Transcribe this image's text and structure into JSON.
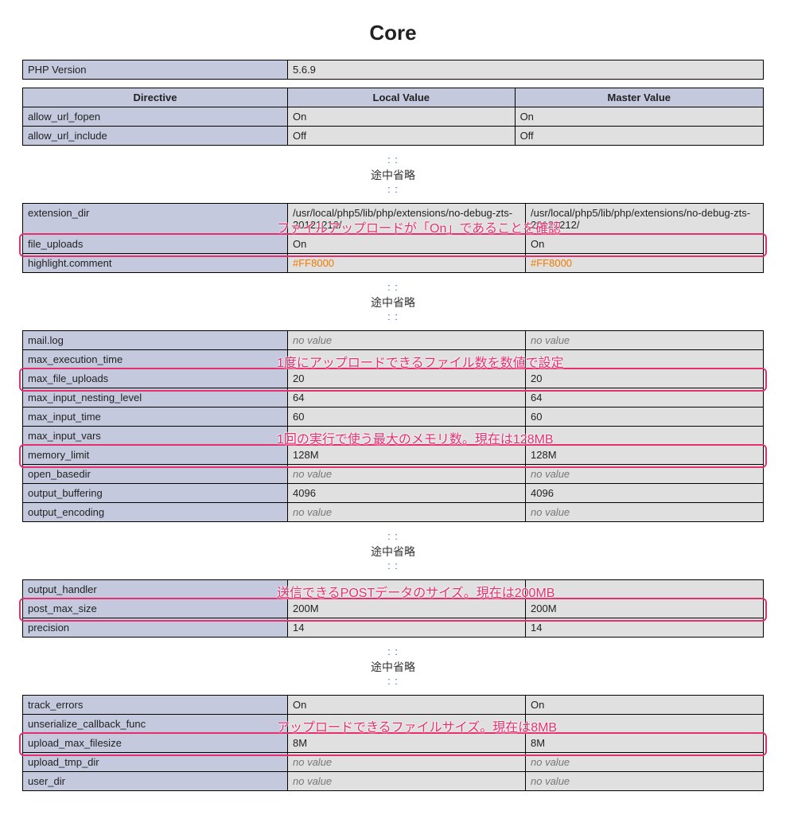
{
  "title": "Core",
  "omit_label": "途中省略",
  "php_version_row": {
    "name": "PHP Version",
    "value": "5.6.9"
  },
  "headers": {
    "directive": "Directive",
    "local": "Local Value",
    "master": "Master Value"
  },
  "section1": [
    {
      "name": "allow_url_fopen",
      "local": "On",
      "master": "On"
    },
    {
      "name": "allow_url_include",
      "local": "Off",
      "master": "Off"
    }
  ],
  "section2": [
    {
      "name": "extension_dir",
      "local": "/usr/local/php5/lib/php/extensions/no-debug-zts-20121212/",
      "master": "/usr/local/php5/lib/php/extensions/no-debug-zts-20121212/"
    },
    {
      "name": "file_uploads",
      "local": "On",
      "master": "On",
      "highlight": true
    },
    {
      "name": "highlight.comment",
      "local": "#FF8000",
      "master": "#FF8000",
      "color": "orange"
    }
  ],
  "section3": [
    {
      "name": "mail.log",
      "local": "no value",
      "master": "no value",
      "style": "italic"
    },
    {
      "name": "max_execution_time",
      "local": "",
      "master": ""
    },
    {
      "name": "max_file_uploads",
      "local": "20",
      "master": "20",
      "highlight": true
    },
    {
      "name": "max_input_nesting_level",
      "local": "64",
      "master": "64"
    },
    {
      "name": "max_input_time",
      "local": "60",
      "master": "60"
    },
    {
      "name": "max_input_vars",
      "local": "",
      "master": ""
    },
    {
      "name": "memory_limit",
      "local": "128M",
      "master": "128M",
      "highlight": true
    },
    {
      "name": "open_basedir",
      "local": "no value",
      "master": "no value",
      "style": "italic"
    },
    {
      "name": "output_buffering",
      "local": "4096",
      "master": "4096"
    },
    {
      "name": "output_encoding",
      "local": "no value",
      "master": "no value",
      "style": "italic"
    }
  ],
  "section4": [
    {
      "name": "output_handler",
      "local": "",
      "master": ""
    },
    {
      "name": "post_max_size",
      "local": "200M",
      "master": "200M",
      "highlight": true
    },
    {
      "name": "precision",
      "local": "14",
      "master": "14"
    }
  ],
  "section5": [
    {
      "name": "track_errors",
      "local": "On",
      "master": "On"
    },
    {
      "name": "unserialize_callback_func",
      "local": "",
      "master": ""
    },
    {
      "name": "upload_max_filesize",
      "local": "8M",
      "master": "8M",
      "highlight": true
    },
    {
      "name": "upload_tmp_dir",
      "local": "no value",
      "master": "no value",
      "style": "italic"
    },
    {
      "name": "user_dir",
      "local": "no value",
      "master": "no value",
      "style": "italic"
    }
  ],
  "annotations": {
    "file_uploads": "ファイルアップロードが「On」であることを確認",
    "max_file_uploads": "1度にアップロードできるファイル数を数値で設定",
    "memory_limit": "1回の実行で使う最大のメモリ数。現在は128MB",
    "post_max_size": "送信できるPOSTデータのサイズ。現在は200MB",
    "upload_max_filesize": "アップロードできるファイルサイズ。現在は8MB"
  }
}
